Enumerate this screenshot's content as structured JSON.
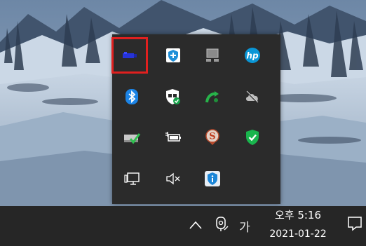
{
  "colors": {
    "taskbar_bg": "#262626",
    "tray_bg": "#2b2b2b",
    "highlight_border": "#e0201f",
    "text": "#ffffff"
  },
  "tray": {
    "icons": [
      {
        "name": "blue-usb-icon",
        "highlighted": true
      },
      {
        "name": "shield-plus-icon"
      },
      {
        "name": "monitor-network-icon"
      },
      {
        "name": "hp-icon",
        "text": "hp"
      },
      {
        "name": "bluetooth-icon"
      },
      {
        "name": "windows-security-shield-icon"
      },
      {
        "name": "green-sync-icon"
      },
      {
        "name": "onedrive-cloud-offline-icon"
      },
      {
        "name": "drive-checkmark-icon"
      },
      {
        "name": "battery-plug-icon"
      },
      {
        "name": "s-badge-icon",
        "text": "S"
      },
      {
        "name": "green-shield-check-icon"
      },
      {
        "name": "network-monitor-icon"
      },
      {
        "name": "speaker-muted-icon"
      },
      {
        "name": "shield-info-icon"
      }
    ]
  },
  "taskbar": {
    "show_hidden_icon": "^",
    "ime_mode_label": "가",
    "clock": {
      "time": "오후 5:16",
      "date": "2021-01-22"
    }
  }
}
